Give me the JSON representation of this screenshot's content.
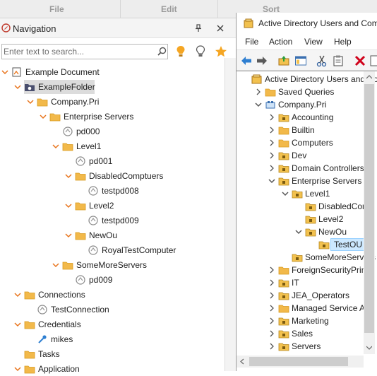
{
  "ribbon": {
    "tabs": [
      "File",
      "Edit",
      "Sort"
    ]
  },
  "navigation": {
    "title": "Navigation",
    "search_placeholder": "Enter text to search...",
    "tree": [
      {
        "label": "Example Document",
        "depth": 0,
        "icon": "document-icon",
        "chevron": "down"
      },
      {
        "label": "ExampleFolder",
        "depth": 1,
        "icon": "special-folder-icon",
        "chevron": "down",
        "selected": true
      },
      {
        "label": "Company.Pri",
        "depth": 2,
        "icon": "folder-icon",
        "chevron": "down"
      },
      {
        "label": "Enterprise Servers",
        "depth": 3,
        "icon": "folder-icon",
        "chevron": "down"
      },
      {
        "label": "pd000",
        "depth": 4,
        "icon": "rdp-icon",
        "chevron": ""
      },
      {
        "label": "Level1",
        "depth": 4,
        "icon": "folder-icon",
        "chevron": "down"
      },
      {
        "label": "pd001",
        "depth": 5,
        "icon": "rdp-icon",
        "chevron": ""
      },
      {
        "label": "DisabledComptuers",
        "depth": 5,
        "icon": "folder-icon",
        "chevron": "down"
      },
      {
        "label": "testpd008",
        "depth": 6,
        "icon": "rdp-icon",
        "chevron": ""
      },
      {
        "label": "Level2",
        "depth": 5,
        "icon": "folder-icon",
        "chevron": "down"
      },
      {
        "label": "testpd009",
        "depth": 6,
        "icon": "rdp-icon",
        "chevron": ""
      },
      {
        "label": "NewOu",
        "depth": 5,
        "icon": "folder-icon",
        "chevron": "down"
      },
      {
        "label": "RoyalTestComputer",
        "depth": 6,
        "icon": "rdp-icon",
        "chevron": ""
      },
      {
        "label": "SomeMoreServers",
        "depth": 4,
        "icon": "folder-icon",
        "chevron": "down"
      },
      {
        "label": "pd009",
        "depth": 5,
        "icon": "rdp-icon",
        "chevron": ""
      },
      {
        "label": "Connections",
        "depth": 1,
        "icon": "folder-icon",
        "chevron": "down"
      },
      {
        "label": "TestConnection",
        "depth": 2,
        "icon": "rdp-icon",
        "chevron": ""
      },
      {
        "label": "Credentials",
        "depth": 1,
        "icon": "folder-icon",
        "chevron": "down"
      },
      {
        "label": "mikes",
        "depth": 2,
        "icon": "key-icon",
        "chevron": ""
      },
      {
        "label": "Tasks",
        "depth": 1,
        "icon": "folder-icon",
        "chevron": ""
      },
      {
        "label": "Application",
        "depth": 1,
        "icon": "folder-icon",
        "chevron": "down"
      }
    ]
  },
  "aduc": {
    "title": "Active Directory Users and Comp",
    "menu": [
      "File",
      "Action",
      "View",
      "Help"
    ],
    "tree": [
      {
        "label": "Active Directory Users and Co",
        "depth": 0,
        "icon": "aduc-icon",
        "chevron": ""
      },
      {
        "label": "Saved Queries",
        "depth": 1,
        "icon": "folder-icon",
        "chevron": "right"
      },
      {
        "label": "Company.Pri",
        "depth": 1,
        "icon": "domain-icon",
        "chevron": "down"
      },
      {
        "label": "Accounting",
        "depth": 2,
        "icon": "ou-icon",
        "chevron": "right"
      },
      {
        "label": "Builtin",
        "depth": 2,
        "icon": "folder-icon",
        "chevron": "right"
      },
      {
        "label": "Computers",
        "depth": 2,
        "icon": "folder-icon",
        "chevron": "right"
      },
      {
        "label": "Dev",
        "depth": 2,
        "icon": "ou-icon",
        "chevron": "right"
      },
      {
        "label": "Domain Controllers",
        "depth": 2,
        "icon": "ou-icon",
        "chevron": "right"
      },
      {
        "label": "Enterprise Servers",
        "depth": 2,
        "icon": "ou-icon",
        "chevron": "down"
      },
      {
        "label": "Level1",
        "depth": 3,
        "icon": "ou-icon",
        "chevron": "down"
      },
      {
        "label": "DisabledComp",
        "depth": 4,
        "icon": "ou-icon",
        "chevron": ""
      },
      {
        "label": "Level2",
        "depth": 4,
        "icon": "ou-icon",
        "chevron": ""
      },
      {
        "label": "NewOu",
        "depth": 4,
        "icon": "ou-icon",
        "chevron": "down"
      },
      {
        "label": "TestOU",
        "depth": 5,
        "icon": "ou-icon",
        "chevron": "",
        "selected": true
      },
      {
        "label": "SomeMoreServers",
        "depth": 3,
        "icon": "ou-icon",
        "chevron": ""
      },
      {
        "label": "ForeignSecurityPrinci",
        "depth": 2,
        "icon": "folder-icon",
        "chevron": "right"
      },
      {
        "label": "IT",
        "depth": 2,
        "icon": "ou-icon",
        "chevron": "right"
      },
      {
        "label": "JEA_Operators",
        "depth": 2,
        "icon": "ou-icon",
        "chevron": "right"
      },
      {
        "label": "Managed Service Acc",
        "depth": 2,
        "icon": "folder-icon",
        "chevron": "right"
      },
      {
        "label": "Marketing",
        "depth": 2,
        "icon": "ou-icon",
        "chevron": "right"
      },
      {
        "label": "Sales",
        "depth": 2,
        "icon": "ou-icon",
        "chevron": "right"
      },
      {
        "label": "Servers",
        "depth": 2,
        "icon": "ou-icon",
        "chevron": "right"
      }
    ]
  },
  "colors": {
    "accent_orange": "#e8731a",
    "folder": "#f2b94a",
    "folder_dark": "#d99a1f",
    "selection": "#cce8ff"
  }
}
